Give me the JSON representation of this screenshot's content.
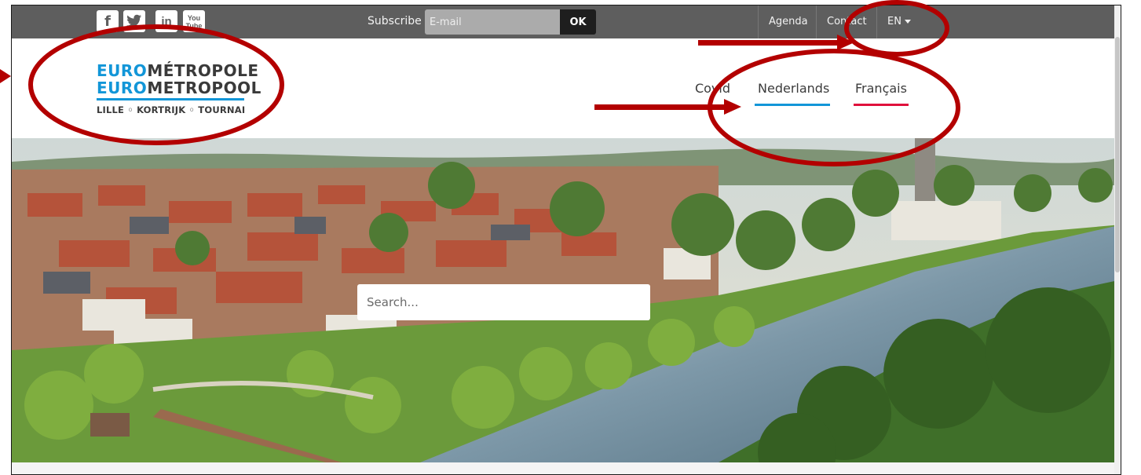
{
  "topbar": {
    "social": [
      {
        "name": "facebook-icon",
        "glyph": "f"
      },
      {
        "name": "twitter-icon",
        "glyph": "t"
      },
      {
        "name": "linkedin-icon",
        "glyph": "in"
      },
      {
        "name": "youtube-icon",
        "glyph": "You\nTube"
      }
    ],
    "subscribe_label": "Subscribe",
    "email_placeholder": "E-mail",
    "ok_label": "OK",
    "agenda": "Agenda",
    "contact": "Contact",
    "lang": "EN"
  },
  "logo": {
    "line1_prefix": "EURO",
    "line1_suffix": "MÉTROPOLE",
    "line2_prefix": "EURO",
    "line2_suffix": "METROPOOL",
    "cities": "LILLE ◦ KORTRIJK ◦ TOURNAI"
  },
  "mainnav": {
    "covid": "Covid",
    "nederlands": "Nederlands",
    "francais": "Français"
  },
  "hero": {
    "search_placeholder": "Search..."
  },
  "colors": {
    "topbar": "#5e5e5e",
    "brand_blue": "#1296d8",
    "brand_red": "#e0103c",
    "annotation_red": "#b30000"
  }
}
